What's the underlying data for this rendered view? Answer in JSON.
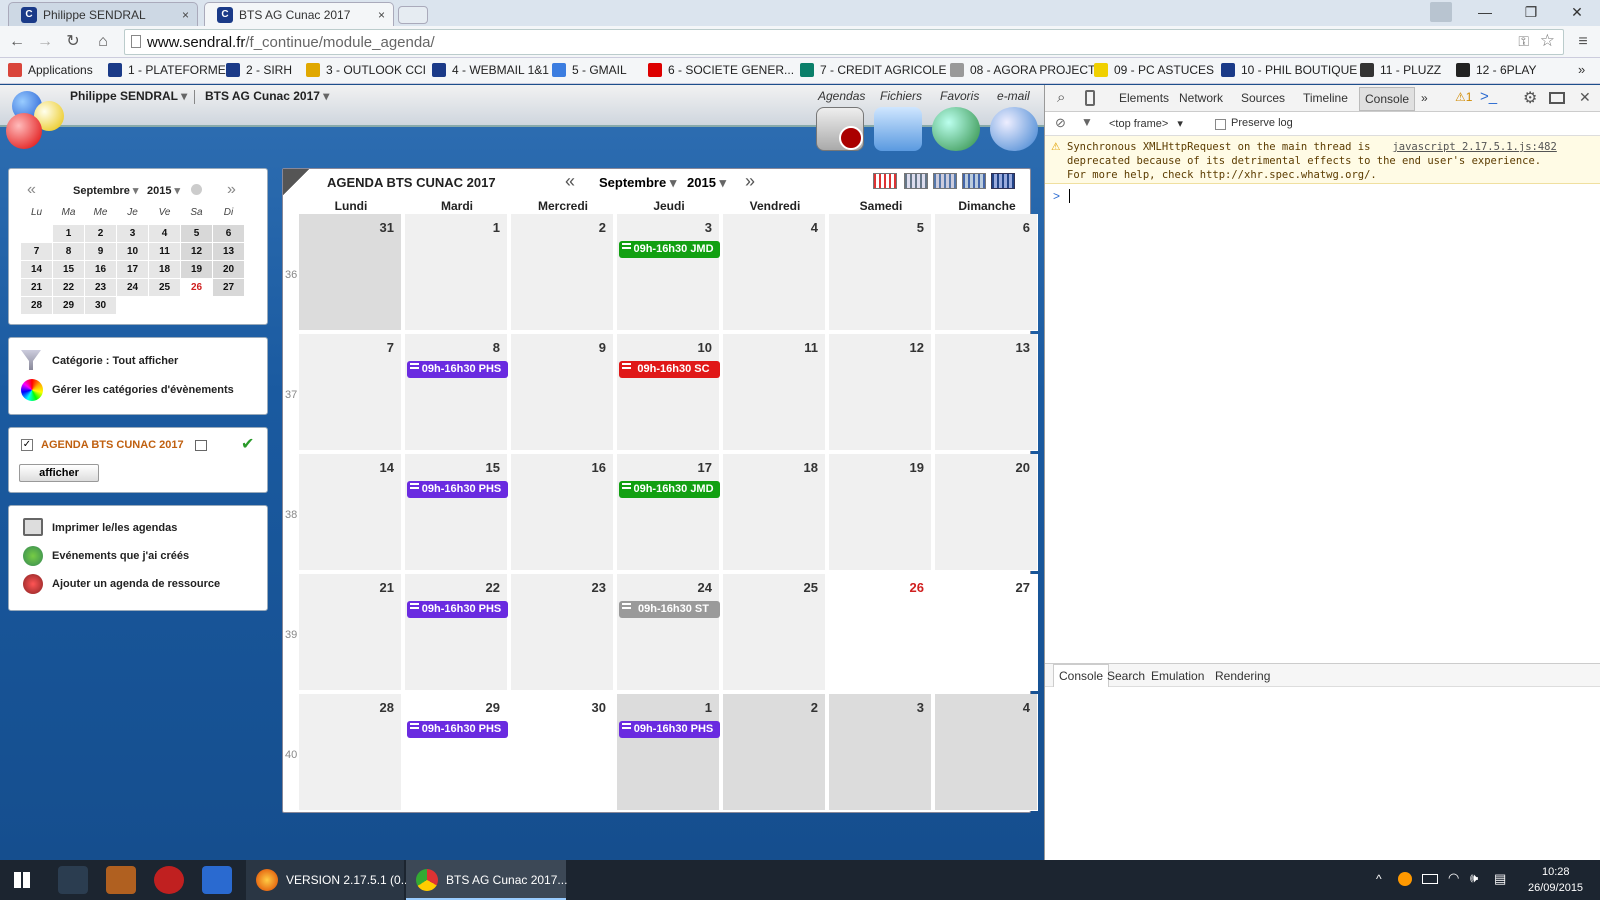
{
  "browser": {
    "tabs": [
      {
        "title": "Philippe SENDRAL",
        "active": false
      },
      {
        "title": "BTS AG Cunac 2017",
        "active": true
      }
    ],
    "url_domain": "www.sendral.fr",
    "url_path": "/f_continue/module_agenda/",
    "bookmarks": [
      {
        "label": "Applications",
        "color": "#d9453b"
      },
      {
        "label": "1 - PLATEFORME",
        "color": "#1a3a88"
      },
      {
        "label": "2 - SIRH",
        "color": "#1a3a88"
      },
      {
        "label": "3 - OUTLOOK CCI",
        "color": "#e0a800"
      },
      {
        "label": "4 - WEBMAIL 1&1",
        "color": "#1a3a88"
      },
      {
        "label": "5 - GMAIL",
        "color": "#3b7de0"
      },
      {
        "label": "6 - SOCIETE GENER...",
        "color": "#d00"
      },
      {
        "label": "7 - CREDIT AGRICOLE",
        "color": "#0a7f6a"
      },
      {
        "label": "08 - AGORA PROJECT",
        "color": "#999"
      },
      {
        "label": "09 - PC ASTUCES",
        "color": "#f0d000"
      },
      {
        "label": "10 - PHIL BOUTIQUE",
        "color": "#1a3a88"
      },
      {
        "label": "11 - PLUZZ",
        "color": "#333"
      },
      {
        "label": "12 - 6PLAY",
        "color": "#222"
      }
    ],
    "more": "»"
  },
  "app": {
    "user_menu": "Philippe SENDRAL",
    "space_menu": "BTS AG Cunac 2017",
    "modules": [
      "Agendas",
      "Fichiers",
      "Favoris",
      "e-mail"
    ]
  },
  "minical": {
    "month": "Septembre",
    "year": "2015",
    "prev": "«",
    "next": "»",
    "dow": [
      "Lu",
      "Ma",
      "Me",
      "Je",
      "Ve",
      "Sa",
      "Di"
    ],
    "weeks": [
      [
        "",
        "1",
        "2",
        "3",
        "4",
        "5",
        "6"
      ],
      [
        "7",
        "8",
        "9",
        "10",
        "11",
        "12",
        "13"
      ],
      [
        "14",
        "15",
        "16",
        "17",
        "18",
        "19",
        "20"
      ],
      [
        "21",
        "22",
        "23",
        "24",
        "25",
        "26",
        "27"
      ],
      [
        "28",
        "29",
        "30",
        "",
        "",
        "",
        ""
      ]
    ],
    "today": "26"
  },
  "categories": {
    "filter_label": "Catégorie : Tout afficher",
    "manage_label": "Gérer les catégories d'évènements"
  },
  "agenda_box": {
    "name": "AGENDA BTS CUNAC 2017",
    "checked": true,
    "button": "afficher"
  },
  "actions": [
    "Imprimer le/les agendas",
    "Evénements que j'ai créés",
    "Ajouter un agenda de ressource"
  ],
  "calendar": {
    "title": "AGENDA BTS CUNAC 2017",
    "month": "Septembre",
    "year": "2015",
    "prev": "«",
    "next": "»",
    "day_headers": [
      "Lundi",
      "Mardi",
      "Mercredi",
      "Jeudi",
      "Vendredi",
      "Samedi",
      "Dimanche"
    ],
    "weeks": [
      {
        "num": "36",
        "days": [
          "31",
          "1",
          "2",
          "3",
          "4",
          "5",
          "6"
        ]
      },
      {
        "num": "37",
        "days": [
          "7",
          "8",
          "9",
          "10",
          "11",
          "12",
          "13"
        ]
      },
      {
        "num": "38",
        "days": [
          "14",
          "15",
          "16",
          "17",
          "18",
          "19",
          "20"
        ]
      },
      {
        "num": "39",
        "days": [
          "21",
          "22",
          "23",
          "24",
          "25",
          "26",
          "27"
        ]
      },
      {
        "num": "40",
        "days": [
          "28",
          "29",
          "30",
          "1",
          "2",
          "3",
          "4"
        ]
      }
    ],
    "events": [
      {
        "week": 0,
        "day": 3,
        "label": "09h-16h30 JMD",
        "color": "#12a012"
      },
      {
        "week": 1,
        "day": 1,
        "label": "09h-16h30 PHS",
        "color": "#6a2be0"
      },
      {
        "week": 1,
        "day": 3,
        "label": "09h-16h30 SC",
        "color": "#e01818"
      },
      {
        "week": 2,
        "day": 1,
        "label": "09h-16h30 PHS",
        "color": "#6a2be0"
      },
      {
        "week": 2,
        "day": 3,
        "label": "09h-16h30 JMD",
        "color": "#12a012"
      },
      {
        "week": 3,
        "day": 1,
        "label": "09h-16h30 PHS",
        "color": "#6a2be0"
      },
      {
        "week": 3,
        "day": 3,
        "label": "09h-16h30 ST",
        "color": "#9a9a9a"
      },
      {
        "week": 4,
        "day": 1,
        "label": "09h-16h30 PHS",
        "color": "#6a2be0"
      },
      {
        "week": 4,
        "day": 3,
        "label": "09h-16h30 PHS",
        "color": "#6a2be0"
      }
    ]
  },
  "devtools": {
    "tabs": [
      "Elements",
      "Network",
      "Sources",
      "Timeline",
      "Console",
      "»"
    ],
    "active_tab": "Console",
    "warning_count": "1",
    "frame": "<top frame>",
    "preserve_log": "Preserve log",
    "message_line1": "Synchronous XMLHttpRequest on the main thread is",
    "message_source": "javascript 2.17.5.1.js:482",
    "message_line2": "deprecated because of its detrimental effects to the end user's experience.",
    "message_line3": "For more help, check http://xhr.spec.whatwg.org/.",
    "prompt": ">",
    "drawer_tabs": [
      "Console",
      "Search",
      "Emulation",
      "Rendering"
    ]
  },
  "taskbar": {
    "apps": [
      "VERSION 2.17.5.1 (0...",
      "BTS AG Cunac 2017..."
    ],
    "time": "10:28",
    "date": "26/09/2015"
  }
}
